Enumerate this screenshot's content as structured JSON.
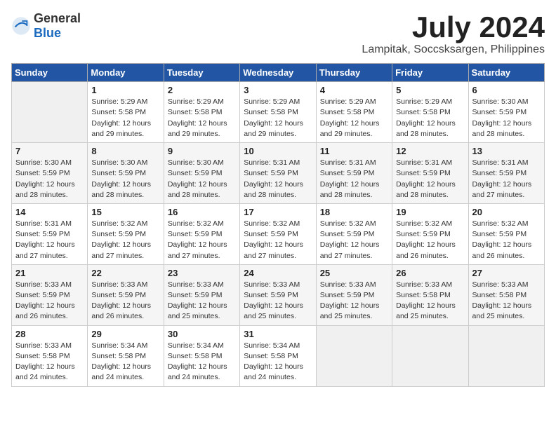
{
  "header": {
    "logo_general": "General",
    "logo_blue": "Blue",
    "month": "July 2024",
    "location": "Lampitak, Soccsksargen, Philippines"
  },
  "weekdays": [
    "Sunday",
    "Monday",
    "Tuesday",
    "Wednesday",
    "Thursday",
    "Friday",
    "Saturday"
  ],
  "weeks": [
    [
      {
        "day": "",
        "info": ""
      },
      {
        "day": "1",
        "info": "Sunrise: 5:29 AM\nSunset: 5:58 PM\nDaylight: 12 hours\nand 29 minutes."
      },
      {
        "day": "2",
        "info": "Sunrise: 5:29 AM\nSunset: 5:58 PM\nDaylight: 12 hours\nand 29 minutes."
      },
      {
        "day": "3",
        "info": "Sunrise: 5:29 AM\nSunset: 5:58 PM\nDaylight: 12 hours\nand 29 minutes."
      },
      {
        "day": "4",
        "info": "Sunrise: 5:29 AM\nSunset: 5:58 PM\nDaylight: 12 hours\nand 29 minutes."
      },
      {
        "day": "5",
        "info": "Sunrise: 5:29 AM\nSunset: 5:58 PM\nDaylight: 12 hours\nand 28 minutes."
      },
      {
        "day": "6",
        "info": "Sunrise: 5:30 AM\nSunset: 5:59 PM\nDaylight: 12 hours\nand 28 minutes."
      }
    ],
    [
      {
        "day": "7",
        "info": "Sunrise: 5:30 AM\nSunset: 5:59 PM\nDaylight: 12 hours\nand 28 minutes."
      },
      {
        "day": "8",
        "info": "Sunrise: 5:30 AM\nSunset: 5:59 PM\nDaylight: 12 hours\nand 28 minutes."
      },
      {
        "day": "9",
        "info": "Sunrise: 5:30 AM\nSunset: 5:59 PM\nDaylight: 12 hours\nand 28 minutes."
      },
      {
        "day": "10",
        "info": "Sunrise: 5:31 AM\nSunset: 5:59 PM\nDaylight: 12 hours\nand 28 minutes."
      },
      {
        "day": "11",
        "info": "Sunrise: 5:31 AM\nSunset: 5:59 PM\nDaylight: 12 hours\nand 28 minutes."
      },
      {
        "day": "12",
        "info": "Sunrise: 5:31 AM\nSunset: 5:59 PM\nDaylight: 12 hours\nand 28 minutes."
      },
      {
        "day": "13",
        "info": "Sunrise: 5:31 AM\nSunset: 5:59 PM\nDaylight: 12 hours\nand 27 minutes."
      }
    ],
    [
      {
        "day": "14",
        "info": "Sunrise: 5:31 AM\nSunset: 5:59 PM\nDaylight: 12 hours\nand 27 minutes."
      },
      {
        "day": "15",
        "info": "Sunrise: 5:32 AM\nSunset: 5:59 PM\nDaylight: 12 hours\nand 27 minutes."
      },
      {
        "day": "16",
        "info": "Sunrise: 5:32 AM\nSunset: 5:59 PM\nDaylight: 12 hours\nand 27 minutes."
      },
      {
        "day": "17",
        "info": "Sunrise: 5:32 AM\nSunset: 5:59 PM\nDaylight: 12 hours\nand 27 minutes."
      },
      {
        "day": "18",
        "info": "Sunrise: 5:32 AM\nSunset: 5:59 PM\nDaylight: 12 hours\nand 27 minutes."
      },
      {
        "day": "19",
        "info": "Sunrise: 5:32 AM\nSunset: 5:59 PM\nDaylight: 12 hours\nand 26 minutes."
      },
      {
        "day": "20",
        "info": "Sunrise: 5:32 AM\nSunset: 5:59 PM\nDaylight: 12 hours\nand 26 minutes."
      }
    ],
    [
      {
        "day": "21",
        "info": "Sunrise: 5:33 AM\nSunset: 5:59 PM\nDaylight: 12 hours\nand 26 minutes."
      },
      {
        "day": "22",
        "info": "Sunrise: 5:33 AM\nSunset: 5:59 PM\nDaylight: 12 hours\nand 26 minutes."
      },
      {
        "day": "23",
        "info": "Sunrise: 5:33 AM\nSunset: 5:59 PM\nDaylight: 12 hours\nand 25 minutes."
      },
      {
        "day": "24",
        "info": "Sunrise: 5:33 AM\nSunset: 5:59 PM\nDaylight: 12 hours\nand 25 minutes."
      },
      {
        "day": "25",
        "info": "Sunrise: 5:33 AM\nSunset: 5:59 PM\nDaylight: 12 hours\nand 25 minutes."
      },
      {
        "day": "26",
        "info": "Sunrise: 5:33 AM\nSunset: 5:58 PM\nDaylight: 12 hours\nand 25 minutes."
      },
      {
        "day": "27",
        "info": "Sunrise: 5:33 AM\nSunset: 5:58 PM\nDaylight: 12 hours\nand 25 minutes."
      }
    ],
    [
      {
        "day": "28",
        "info": "Sunrise: 5:33 AM\nSunset: 5:58 PM\nDaylight: 12 hours\nand 24 minutes."
      },
      {
        "day": "29",
        "info": "Sunrise: 5:34 AM\nSunset: 5:58 PM\nDaylight: 12 hours\nand 24 minutes."
      },
      {
        "day": "30",
        "info": "Sunrise: 5:34 AM\nSunset: 5:58 PM\nDaylight: 12 hours\nand 24 minutes."
      },
      {
        "day": "31",
        "info": "Sunrise: 5:34 AM\nSunset: 5:58 PM\nDaylight: 12 hours\nand 24 minutes."
      },
      {
        "day": "",
        "info": ""
      },
      {
        "day": "",
        "info": ""
      },
      {
        "day": "",
        "info": ""
      }
    ]
  ]
}
